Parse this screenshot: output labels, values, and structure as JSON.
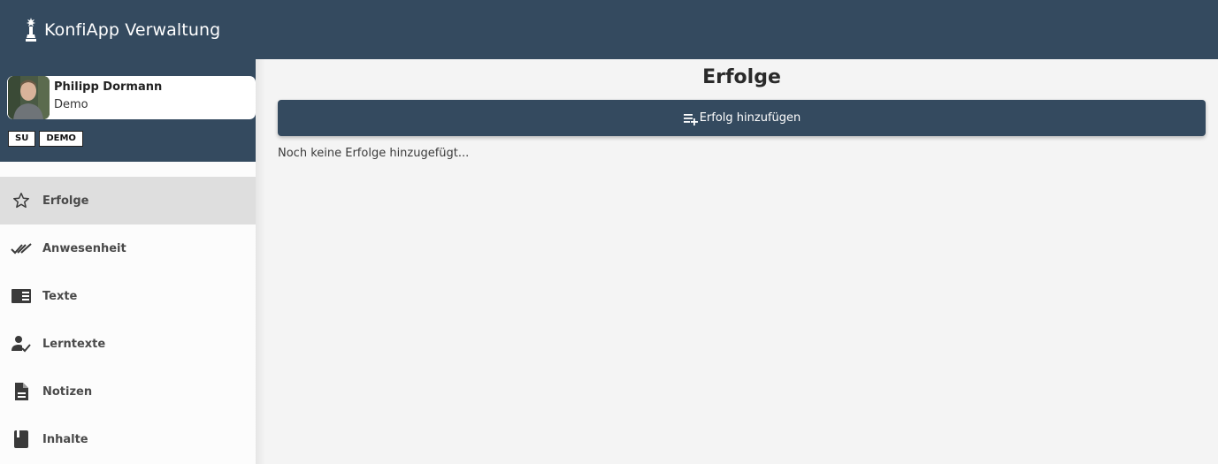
{
  "header": {
    "title": "KonfiApp Verwaltung",
    "logo_icon": "chess-king-icon"
  },
  "profile": {
    "name": "Philipp Dormann",
    "role": "Demo",
    "badges": [
      "SU",
      "DEMO"
    ]
  },
  "sidebar": {
    "items": [
      {
        "label": "Erfolge",
        "icon": "star-outline-icon",
        "active": true
      },
      {
        "label": "Anwesenheit",
        "icon": "double-check-icon",
        "active": false
      },
      {
        "label": "Texte",
        "icon": "book-open-icon",
        "active": false
      },
      {
        "label": "Lerntexte",
        "icon": "person-check-icon",
        "active": false
      },
      {
        "label": "Notizen",
        "icon": "document-icon",
        "active": false
      },
      {
        "label": "Inhalte",
        "icon": "book-icon",
        "active": false
      }
    ]
  },
  "main": {
    "title": "Erfolge",
    "add_button_label": "Erfolg hinzufügen",
    "empty_text": "Noch keine Erfolge hinzugefügt..."
  },
  "colors": {
    "primary": "#344a5f",
    "active_item_bg": "#dedede",
    "page_bg": "#f4f4f4"
  }
}
